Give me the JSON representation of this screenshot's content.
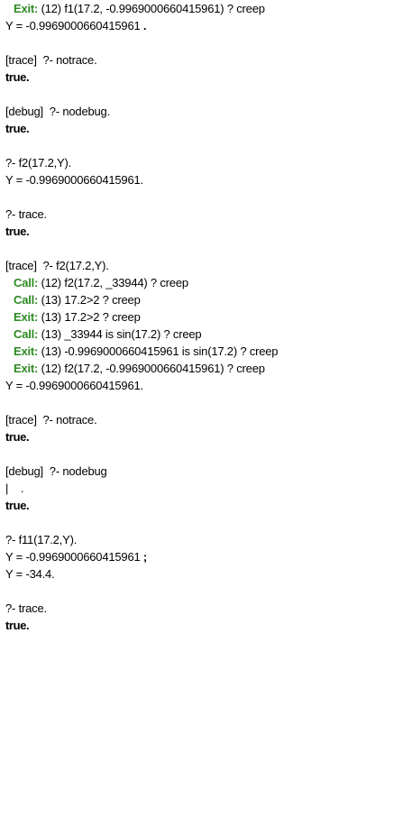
{
  "console": {
    "l01": {
      "port": "Exit:",
      "text": " (12) f1(17.2, -0.9969000660415961) ? creep"
    },
    "l02": {
      "text": "Y = -0.9969000660415961 ",
      "tail": "."
    },
    "l04": {
      "text": "[trace]  ?- notrace."
    },
    "l05": {
      "text": "true",
      "tail": "."
    },
    "l07": {
      "text": "[debug]  ?- nodebug."
    },
    "l08": {
      "text": "true",
      "tail": "."
    },
    "l10": {
      "text": "?- f2(17.2,Y)."
    },
    "l11": {
      "text": "Y = -0.9969000660415961."
    },
    "l13": {
      "text": "?- trace."
    },
    "l14": {
      "text": "true",
      "tail": "."
    },
    "l16": {
      "text": "[trace]  ?- f2(17.2,Y)."
    },
    "l17": {
      "port": "Call:",
      "text": " (12) f2(17.2, _33944) ? creep"
    },
    "l18": {
      "port": "Call:",
      "text": " (13) 17.2>2 ? creep"
    },
    "l19": {
      "port": "Exit:",
      "text": " (13) 17.2>2 ? creep"
    },
    "l20": {
      "port": "Call:",
      "text": " (13) _33944 is sin(17.2) ? creep"
    },
    "l21": {
      "port": "Exit:",
      "text": " (13) -0.9969000660415961 is sin(17.2) ? creep"
    },
    "l22": {
      "port": "Exit:",
      "text": " (12) f2(17.2, -0.9969000660415961) ? creep"
    },
    "l23": {
      "text": "Y = -0.9969000660415961."
    },
    "l25": {
      "text": "[trace]  ?- notrace."
    },
    "l26": {
      "text": "true",
      "tail": "."
    },
    "l28": {
      "text": "[debug]  ?- nodebug"
    },
    "l29": {
      "text": "|    ."
    },
    "l30": {
      "text": "true",
      "tail": "."
    },
    "l32": {
      "text": "?- f11(17.2,Y)."
    },
    "l33": {
      "text": "Y = -0.9969000660415961 ",
      "tail": ";"
    },
    "l34": {
      "text": "Y = -34.4."
    },
    "l36": {
      "text": "?- trace."
    },
    "l37": {
      "text": "true",
      "tail": "."
    }
  }
}
